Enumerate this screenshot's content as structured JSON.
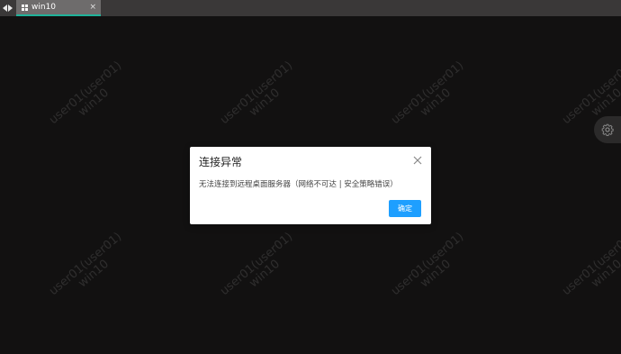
{
  "tab": {
    "label": "win10",
    "close_glyph": "×"
  },
  "watermark": {
    "line1": "user01(user01)",
    "line2": "win10"
  },
  "dialog": {
    "title": "连接异常",
    "message": "无法连接到远程桌面服务器（网络不可达 | 安全策略错误）",
    "confirm_label": "确定"
  },
  "colors": {
    "background": "#121111",
    "topbar": "#3a3838",
    "tab_active": "#6e6c6c",
    "tab_indicator": "#1fb39a",
    "primary_button": "#1e9fff"
  },
  "icons": {
    "nav": [
      "arrow-left-icon",
      "arrow-right-icon"
    ],
    "tab": "windows-icon",
    "dialog_close": "close-icon",
    "side": "gear-icon"
  }
}
